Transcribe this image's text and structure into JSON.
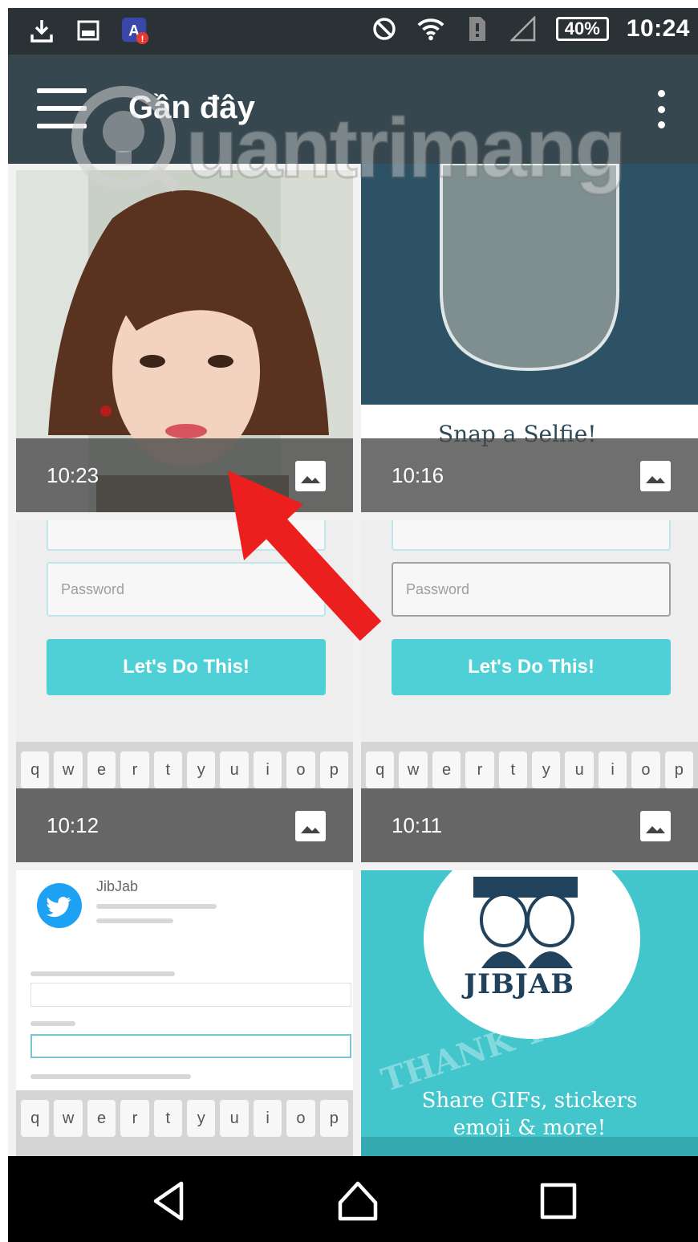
{
  "status_bar": {
    "icons": [
      "download-icon",
      "gallery-icon",
      "app-notification-icon",
      "do-not-disturb-icon",
      "wifi-icon",
      "sim-icon",
      "signal-icon"
    ],
    "battery": "40%",
    "time": "10:24"
  },
  "app_bar": {
    "title": "Gần đây",
    "menu_icon": "hamburger-menu-icon",
    "overflow_icon": "more-vert-icon"
  },
  "watermark": {
    "text": "uantrimang"
  },
  "tiles": [
    {
      "time": "10:23",
      "icon": "image-icon"
    },
    {
      "time": "10:16",
      "icon": "image-icon",
      "title": "Snap a Selfie!"
    },
    {
      "time": "10:12",
      "icon": "image-icon",
      "password_placeholder": "Password",
      "button": "Let's Do This!"
    },
    {
      "time": "10:11",
      "icon": "image-icon",
      "password_placeholder": "Password",
      "button": "Let's Do This!"
    },
    {
      "app_name": "JibJab"
    },
    {
      "brand": "JIBJAB",
      "tagline_1": "Share GIFs, stickers",
      "tagline_2": "emoji & more!"
    }
  ],
  "keyboard": {
    "row": [
      "q",
      "w",
      "e",
      "r",
      "t",
      "y",
      "u",
      "i",
      "o",
      "p"
    ]
  },
  "nav_bar": {
    "back_icon": "back-icon",
    "home_icon": "home-icon",
    "recents_icon": "recents-icon"
  },
  "colors": {
    "status_bar": "#2b3236",
    "app_bar": "#37474f",
    "accent": "#4fd0d6",
    "arrow": "#ec1f1f"
  }
}
